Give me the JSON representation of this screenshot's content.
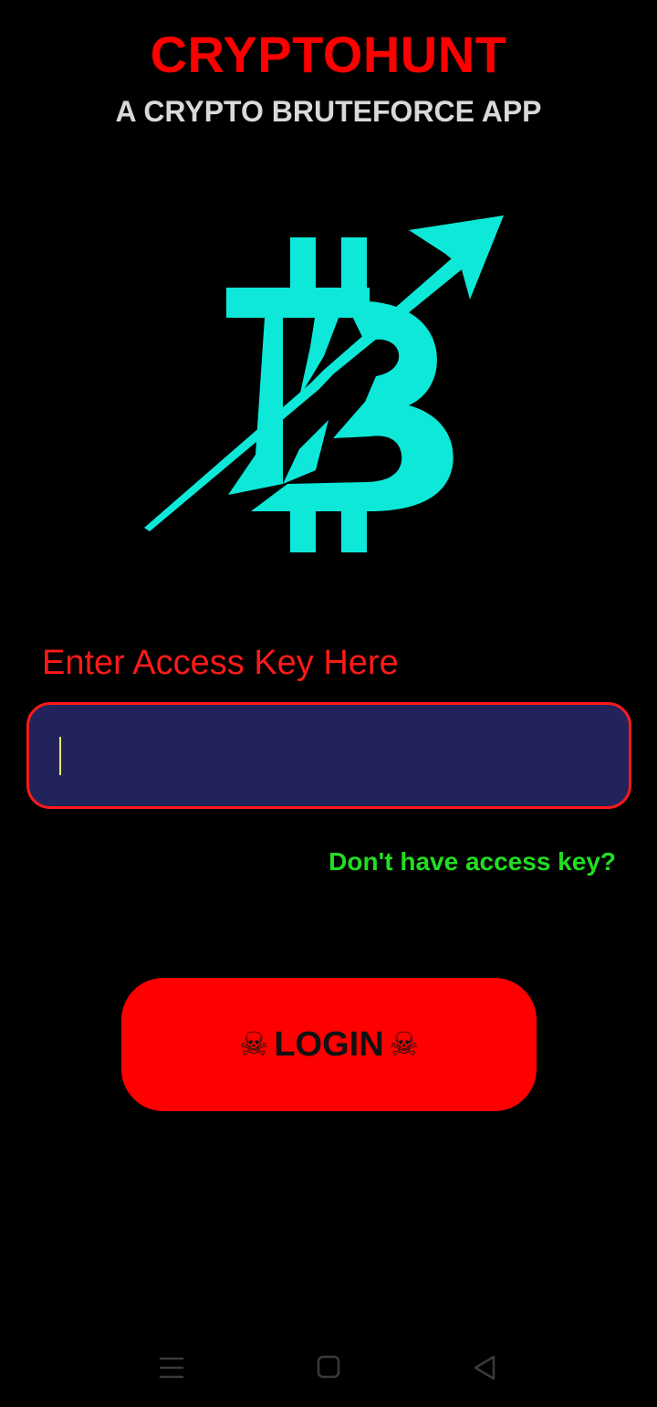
{
  "header": {
    "title": "CRYPTOHUNT",
    "subtitle": "A CRYPTO BRUTEFORCE APP"
  },
  "logo": {
    "icon": "bitcoin-arrow-logo",
    "color": "#0ee8d8"
  },
  "form": {
    "label": "Enter Access Key Here",
    "input_value": "",
    "no_key_link": "Don't have access key?",
    "login_label": "LOGIN",
    "login_icon": "☠"
  },
  "system_nav": {
    "items": [
      "menu-icon",
      "home-icon",
      "back-icon"
    ]
  },
  "colors": {
    "accent": "#ff0000",
    "input_bg": "#23235c",
    "link": "#22dd22",
    "background": "#000000"
  }
}
